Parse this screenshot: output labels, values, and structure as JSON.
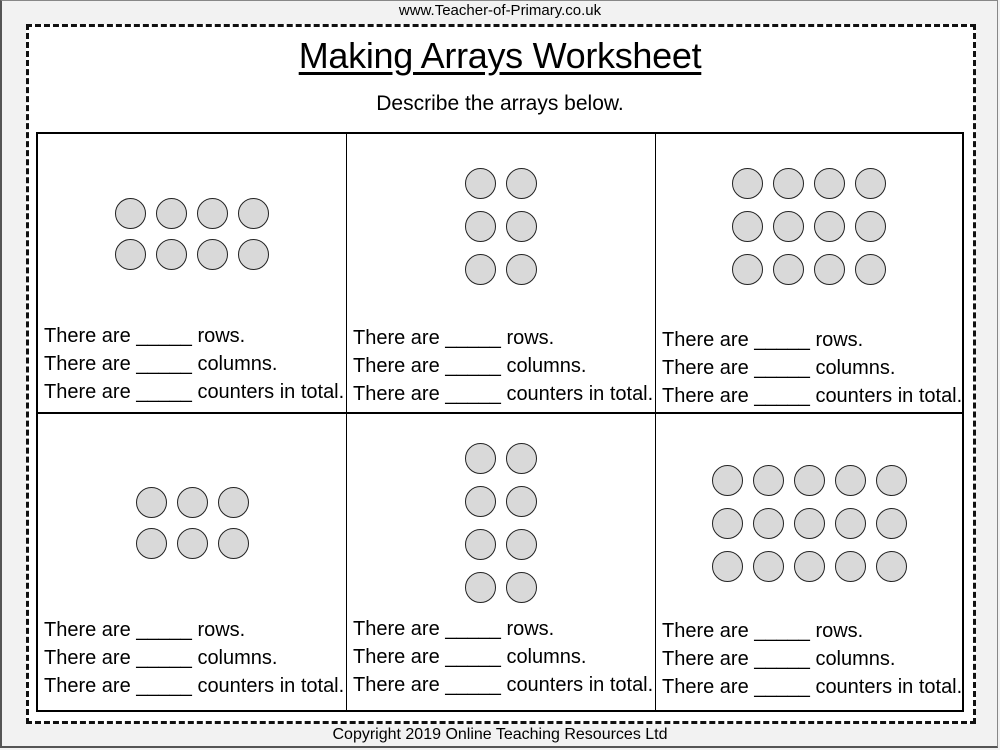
{
  "header": {
    "site_url": "www.Teacher-of-Primary.co.uk",
    "title": "Making Arrays Worksheet",
    "instruction": "Describe the arrays below."
  },
  "worksheet": {
    "line_templates": [
      "There are _____ rows.",
      "There are _____ columns.",
      "There are _____ counters in total."
    ],
    "counter_color": "#d9d9d9",
    "arrays": [
      {
        "rows": 2,
        "columns": 4,
        "lines": [
          "There are _____ rows.",
          "There are _____ columns.",
          "There are _____ counters in total."
        ]
      },
      {
        "rows": 3,
        "columns": 2,
        "lines": [
          "There are _____ rows.",
          "There are _____ columns.",
          "There are _____ counters in total."
        ]
      },
      {
        "rows": 3,
        "columns": 4,
        "lines": [
          "There are _____ rows.",
          "There are _____ columns.",
          "There are _____ counters in total."
        ]
      },
      {
        "rows": 2,
        "columns": 3,
        "lines": [
          "There are _____ rows.",
          "There are _____ columns.",
          "There are _____ counters in total."
        ]
      },
      {
        "rows": 4,
        "columns": 2,
        "lines": [
          "There are _____ rows.",
          "There are _____ columns.",
          "There are _____ counters in total."
        ]
      },
      {
        "rows": 3,
        "columns": 5,
        "lines": [
          "There are _____ rows.",
          "There are _____ columns.",
          "There are _____ counters in total."
        ]
      }
    ]
  },
  "footer": {
    "copyright": "Copyright 2019 Online Teaching Resources Ltd"
  }
}
